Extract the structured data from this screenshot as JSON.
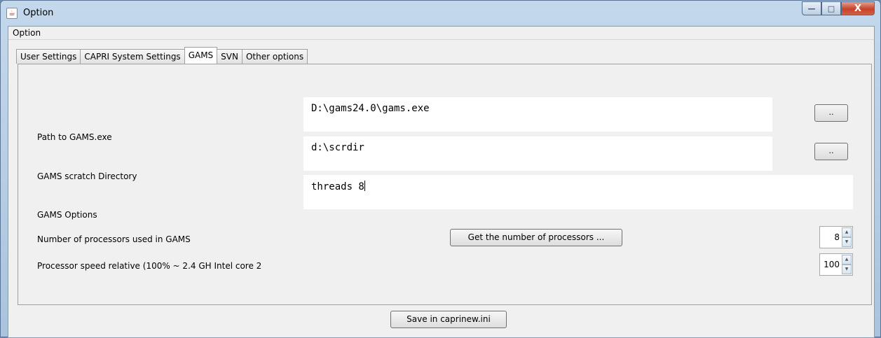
{
  "window": {
    "title": "Option",
    "app_icon": "java-cup-icon",
    "controls": {
      "minimize": "—",
      "maximize": "□",
      "close": "X"
    }
  },
  "menubar": {
    "option": "Option"
  },
  "tabs": [
    {
      "label": "User Settings",
      "active": false
    },
    {
      "label": "CAPRI System Settings",
      "active": false
    },
    {
      "label": "GAMS",
      "active": true
    },
    {
      "label": "SVN",
      "active": false
    },
    {
      "label": "Other options",
      "active": false
    }
  ],
  "gams": {
    "path_label": "Path to GAMS.exe",
    "path_value": "D:\\gams24.0\\gams.exe",
    "scratch_label": "GAMS scratch Directory",
    "scratch_value": "d:\\scrdir",
    "options_label": "GAMS Options",
    "options_value": "threads 8",
    "browse_label": "..",
    "processors_label": "Number of processors used in GAMS",
    "get_processors_button": "Get the number of processors ...",
    "processors_value": "8",
    "speed_label": "Processor speed relative (100% ~ 2.4 GH Intel core 2",
    "speed_value": "100",
    "spin_up": "▲",
    "spin_down": "▼"
  },
  "footer": {
    "save_button": "Save in caprinew.ini"
  }
}
